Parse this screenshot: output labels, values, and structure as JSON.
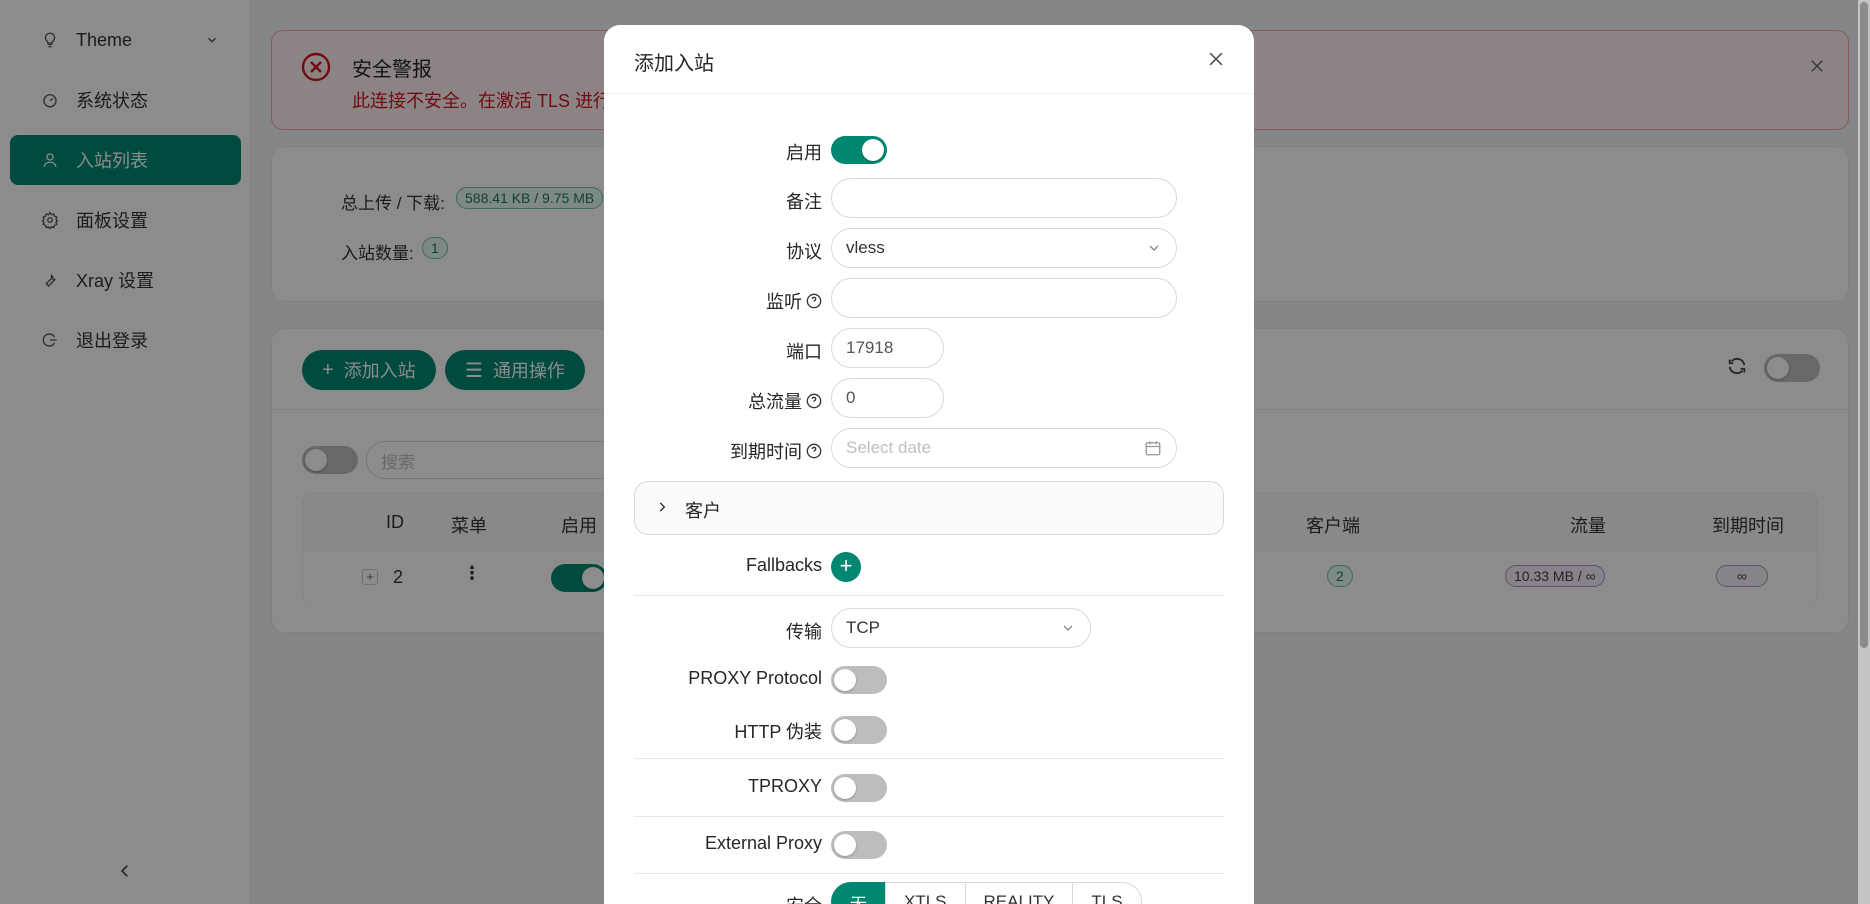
{
  "sidebar": {
    "items": [
      {
        "label": "Theme"
      },
      {
        "label": "系统状态"
      },
      {
        "label": "入站列表"
      },
      {
        "label": "面板设置"
      },
      {
        "label": "Xray 设置"
      },
      {
        "label": "退出登录"
      }
    ]
  },
  "alert": {
    "title": "安全警报",
    "text": "此连接不安全。在激活 TLS 进行数据保护之前，请勿输入敏感信息。"
  },
  "stats": {
    "traffic_label": "总上传 / 下载:",
    "traffic_value": "588.41 KB / 9.75 MB",
    "count_label": "入站数量:",
    "count_value": "1"
  },
  "toolbar": {
    "add_label": "添加入站",
    "general_label": "通用操作",
    "search_placeholder": "搜索"
  },
  "table": {
    "headers": {
      "id": "ID",
      "menu": "菜单",
      "enable": "启用",
      "clients": "客户端",
      "traffic": "流量",
      "expiry": "到期时间"
    },
    "row": {
      "id": "2",
      "clients": "2",
      "traffic": "10.33 MB / ∞",
      "expiry": "∞"
    }
  },
  "modal": {
    "title": "添加入站",
    "fields": {
      "enable": "启用",
      "remark": "备注",
      "protocol": "协议",
      "protocol_value": "vless",
      "listen": "监听",
      "port": "端口",
      "port_value": "17918",
      "total": "总流量",
      "total_value": "0",
      "expiry": "到期时间",
      "expiry_placeholder": "Select date",
      "clients": "客户",
      "fallbacks": "Fallbacks",
      "transport": "传输",
      "transport_value": "TCP",
      "proxy_protocol": "PROXY Protocol",
      "http_obfs": "HTTP 伪装",
      "tproxy": "TPROXY",
      "external_proxy": "External Proxy",
      "security": "安全"
    },
    "security_options": [
      "无",
      "XTLS",
      "REALITY",
      "TLS"
    ]
  },
  "colors": {
    "accent": "#008771",
    "danger": "#cf1322"
  }
}
